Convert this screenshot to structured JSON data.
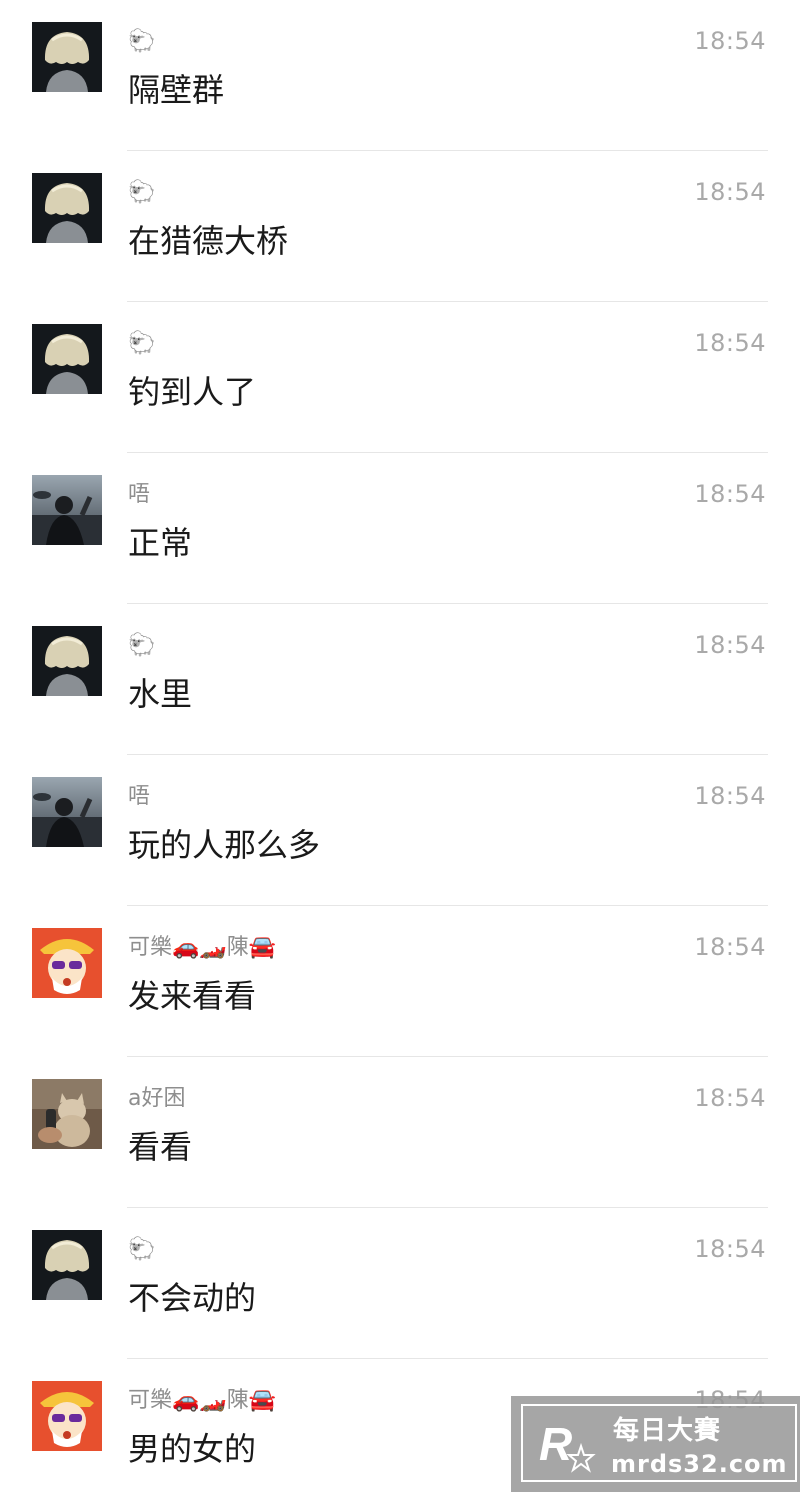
{
  "messages": [
    {
      "sender": "🐑",
      "time": "18:54",
      "text": "隔壁群",
      "avatar": "blonde-avatar"
    },
    {
      "sender": "🐑",
      "time": "18:54",
      "text": "在猎德大桥",
      "avatar": "blonde-avatar"
    },
    {
      "sender": "🐑",
      "time": "18:54",
      "text": "钓到人了",
      "avatar": "blonde-avatar"
    },
    {
      "sender": "唔",
      "time": "18:54",
      "text": "正常",
      "avatar": "rain-avatar"
    },
    {
      "sender": "🐑",
      "time": "18:54",
      "text": "水里",
      "avatar": "blonde-avatar"
    },
    {
      "sender": "唔",
      "time": "18:54",
      "text": "玩的人那么多",
      "avatar": "rain-avatar"
    },
    {
      "sender": "可樂🚗🏎️陳🚘",
      "time": "18:54",
      "text": "发来看看",
      "avatar": "god-avatar"
    },
    {
      "sender": "a好困",
      "time": "18:54",
      "text": "看看",
      "avatar": "cat-avatar"
    },
    {
      "sender": "🐑",
      "time": "18:54",
      "text": "不会动的",
      "avatar": "blonde-avatar"
    },
    {
      "sender": "可樂🚗🏎️陳🚘",
      "time": "18:54",
      "text": "男的女的",
      "avatar": "god-avatar"
    }
  ],
  "watermark": {
    "title": "每日大賽",
    "url": "mrds32.com"
  }
}
